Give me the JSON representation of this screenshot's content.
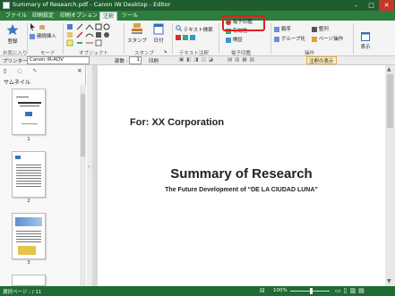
{
  "titlebar": {
    "title": "Summary of Research.pdf - Canon iW Desktop - Editor"
  },
  "menubar": {
    "tabs": [
      "ファイル",
      "印刷設定",
      "印刷オプション",
      "注釈",
      "ツール"
    ],
    "active_tab": "注釈"
  },
  "ribbon": {
    "favorites_label": "登録",
    "group_favorites": "お気に入り",
    "group_mode": "モード",
    "mode_item": "連続挿入",
    "group_object": "オブジェクト",
    "stamp_label": "スタンプ",
    "date_label": "日付",
    "group_stamp": "スタンプ",
    "text_search": "テキスト検索",
    "group_text_annotation": "テキスト注釈",
    "electronic_seal": "電子印鑑",
    "validity": "有効性",
    "verify": "検証",
    "group_electronic_seal": "電子印鑑",
    "order": "順序",
    "group_ungroup": "グループ化",
    "align": "整列",
    "page_operation": "ページ操作",
    "group_operation": "操作",
    "view_label": "表示"
  },
  "toolbar2": {
    "printer_label": "プリンター :",
    "printer_value": "Canon iR-ADV",
    "copies_label": "部数 :",
    "copies_value": "1",
    "print_label": "印刷",
    "show_annotations": "注釈の表示"
  },
  "leftpanel": {
    "tab_label": "サムネイル",
    "thumbnails": [
      {
        "page": "1"
      },
      {
        "page": "2"
      },
      {
        "page": "3"
      }
    ]
  },
  "thumb1": {
    "title": "Summary of Research",
    "sub": "For: XX Corporation"
  },
  "document": {
    "for_line": "For: XX Corporation",
    "title": "Summary of Research",
    "subtitle": "The Future Development of “DE LA CIUDAD LUNA”"
  },
  "statusbar": {
    "page_info": "選択ページ : / 11",
    "zoom": "100%"
  }
}
